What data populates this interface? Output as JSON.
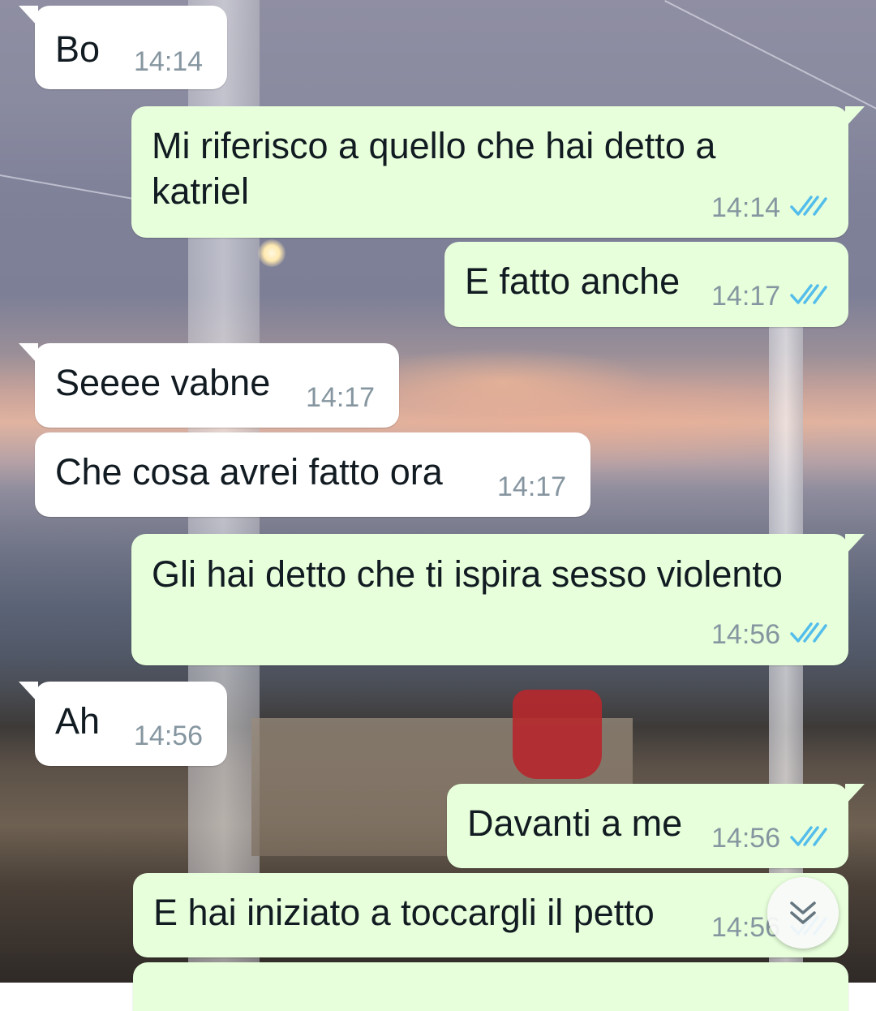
{
  "messages": [
    {
      "text": "Bo",
      "time": "14:14",
      "direction": "incoming"
    },
    {
      "text_lines": [
        "Mi riferisco a quello che hai detto a",
        "katriel"
      ],
      "time": "14:14",
      "direction": "outgoing",
      "status": "read"
    },
    {
      "text": "E fatto anche",
      "time": "14:17",
      "direction": "outgoing",
      "status": "read"
    },
    {
      "text": "Seeee vabne",
      "time": "14:17",
      "direction": "incoming"
    },
    {
      "text": "Che cosa avrei fatto ora",
      "time": "14:17",
      "direction": "incoming"
    },
    {
      "text": "Gli hai detto che ti ispira sesso violento",
      "time": "14:56",
      "direction": "outgoing",
      "status": "read"
    },
    {
      "text": "Ah",
      "time": "14:56",
      "direction": "incoming"
    },
    {
      "text": "Davanti a me",
      "time": "14:56",
      "direction": "outgoing",
      "status": "read"
    },
    {
      "text": "E hai iniziato a toccargli il petto",
      "time": "14:56",
      "direction": "outgoing",
      "status": "read"
    }
  ],
  "colors": {
    "incoming_bubble": "#ffffff",
    "outgoing_bubble": "#e7ffdb",
    "timestamp": "#8696a0",
    "read_ticks": "#53bdeb"
  },
  "icons": {
    "read_receipt": "double-check-icon",
    "scroll_down": "double-chevron-down-icon"
  }
}
